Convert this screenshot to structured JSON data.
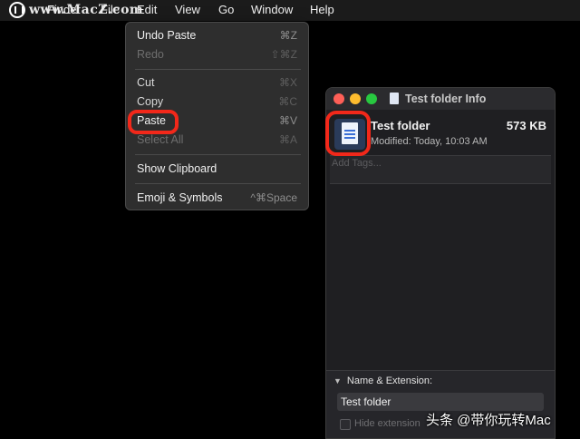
{
  "menubar": {
    "watermark": "www.MacZ.com",
    "items": [
      "Finder",
      "File",
      "Edit",
      "View",
      "Go",
      "Window",
      "Help"
    ]
  },
  "edit_menu": {
    "items": [
      {
        "label": "Undo Paste",
        "shortcut": "⌘Z",
        "enabled": true
      },
      {
        "label": "Redo",
        "shortcut": "⇧⌘Z",
        "enabled": false
      },
      {
        "label": "Cut",
        "shortcut": "⌘X",
        "enabled": false
      },
      {
        "label": "Copy",
        "shortcut": "⌘C",
        "enabled": false
      },
      {
        "label": "Paste",
        "shortcut": "⌘V",
        "enabled": true
      },
      {
        "label": "Select All",
        "shortcut": "⌘A",
        "enabled": false
      },
      {
        "label": "Show Clipboard",
        "shortcut": "",
        "enabled": true
      },
      {
        "label": "Emoji & Symbols",
        "shortcut": "^⌘Space",
        "enabled": true
      }
    ]
  },
  "info_window": {
    "title": "Test folder Info",
    "name": "Test folder",
    "size": "573 KB",
    "modified": "Modified: Today, 10:03 AM",
    "tags_placeholder": "Add Tags...",
    "section_title": "Name & Extension:",
    "name_field_value": "Test folder",
    "hide_extension_label": "Hide extension"
  },
  "footer_watermark": "头条 @带你玩转Mac",
  "colors": {
    "highlight": "#f2281a",
    "close": "#fe5f57",
    "minimize": "#febc2e",
    "zoom": "#28c840"
  }
}
